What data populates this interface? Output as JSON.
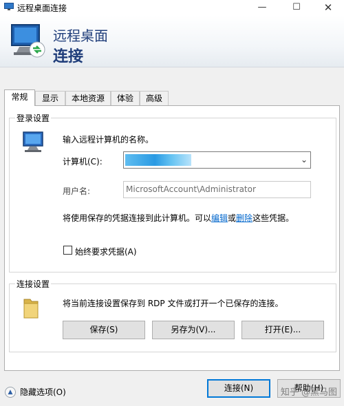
{
  "window": {
    "title": "远程桌面连接",
    "controls": {
      "minimize": "—",
      "maximize": "☐",
      "close": "✕"
    }
  },
  "banner": {
    "line1": "远程桌面",
    "line2": "连接"
  },
  "tabs": [
    {
      "label": "常规",
      "active": true
    },
    {
      "label": "显示",
      "active": false
    },
    {
      "label": "本地资源",
      "active": false
    },
    {
      "label": "体验",
      "active": false
    },
    {
      "label": "高级",
      "active": false
    }
  ],
  "login_settings": {
    "group_label": "登录设置",
    "instruction": "输入远程计算机的名称。",
    "computer_label": "计算机(C):",
    "computer_value": "",
    "username_label": "用户名:",
    "username_value": "MicrosoftAccount\\Administrator",
    "credential_text": "将使用保存的凭据连接到此计算机。可以",
    "edit_link": "编辑",
    "or_text": "或",
    "delete_link": "删除",
    "credential_suffix": "这些凭据。",
    "always_ask_label": "始终要求凭据(A)",
    "always_ask_checked": false
  },
  "connection_settings": {
    "group_label": "连接设置",
    "description": "将当前连接设置保存到 RDP 文件或打开一个已保存的连接。",
    "save_button": "保存(S)",
    "save_as_button": "另存为(V)...",
    "open_button": "打开(E)..."
  },
  "footer": {
    "hide_options": "隐藏选项(O)",
    "connect_button": "连接(N)",
    "help_button": "帮助(H)",
    "watermark": "知乎 @黑马图"
  },
  "icons": {
    "app": "remote-desktop-icon",
    "computer": "computer-icon",
    "folder": "folder-icon",
    "chevron": "chevron-down-icon",
    "collapse": "chevron-up-icon"
  }
}
